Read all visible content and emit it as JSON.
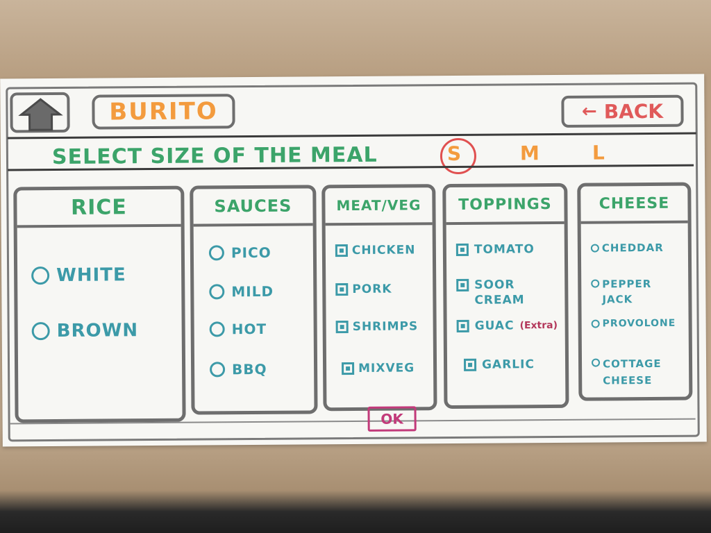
{
  "header": {
    "title": "BURITO",
    "back_label": "BACK"
  },
  "size": {
    "label": "SELECT SIZE OF THE MEAL",
    "options": [
      "S",
      "M",
      "L"
    ],
    "selected": "S"
  },
  "panels": [
    {
      "title": "RICE",
      "control": "radio",
      "items": [
        "WHITE",
        "BROWN"
      ]
    },
    {
      "title": "SAUCES",
      "control": "radio",
      "items": [
        "PICO",
        "MILD",
        "HOT",
        "BBQ"
      ]
    },
    {
      "title": "MEAT/VEG",
      "control": "checkbox",
      "items": [
        "CHICKEN",
        "PORK",
        "SHRIMPS",
        "MIXVEG"
      ]
    },
    {
      "title": "TOPPINGS",
      "control": "checkbox",
      "items": [
        "TOMATO",
        "SOOR CREAM",
        "GUAC",
        "GARLIC"
      ],
      "note": "(Extra)"
    },
    {
      "title": "CHEESE",
      "control": "radio",
      "items": [
        "CHEDDAR",
        "PEPPER JACK",
        "PROVOLONE",
        "COTTAGE CHEESE"
      ]
    }
  ],
  "footer": {
    "ok_label": "OK"
  },
  "colors": {
    "green": "#3ca46a",
    "teal": "#3c9aa8",
    "orange": "#f39b3e",
    "red": "#e05a5a",
    "magenta": "#c23a7a"
  }
}
